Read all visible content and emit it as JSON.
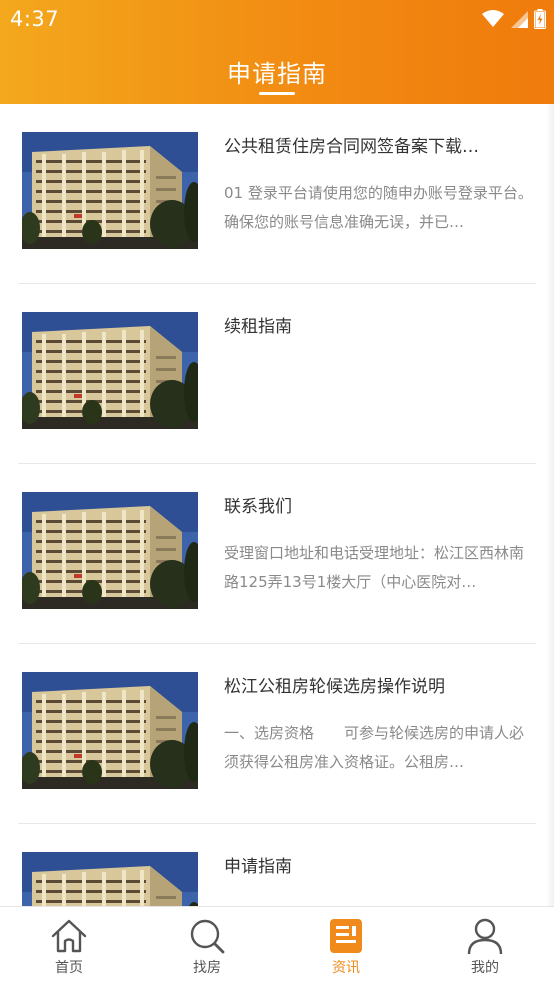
{
  "status_bar": {
    "time": "4:37"
  },
  "header": {
    "title": "申请指南"
  },
  "articles": [
    {
      "title": "公共租赁住房合同网签备案下载…",
      "summary": "01 登录平台请使用您的随申办账号登录平台。确保您的账号信息准确无误，并已…"
    },
    {
      "title": "续租指南",
      "summary": ""
    },
    {
      "title": "联系我们",
      "summary": "受理窗口地址和电话受理地址：松江区西林南路125弄13号1楼大厅（中心医院对…"
    },
    {
      "title": "松江公租房轮候选房操作说明",
      "summary": "一、选房资格　　可参与轮候选房的申请人必须获得公租房准入资格证。公租房…"
    },
    {
      "title": "申请指南",
      "summary": ""
    }
  ],
  "tabbar": {
    "active": "资讯",
    "accent_color": "#f08a1b",
    "items": [
      {
        "label": "首页",
        "icon": "home-icon"
      },
      {
        "label": "找房",
        "icon": "search-icon"
      },
      {
        "label": "资讯",
        "icon": "news-icon"
      },
      {
        "label": "我的",
        "icon": "user-icon"
      }
    ]
  },
  "colors": {
    "header_start": "#f3a81d",
    "header_end": "#ef7b0c"
  }
}
